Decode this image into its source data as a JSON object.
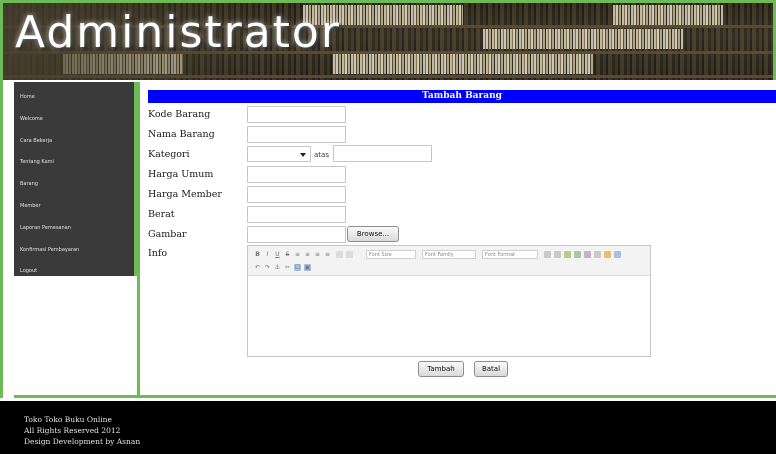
{
  "header": {
    "title": "Administrator"
  },
  "sidebar": {
    "items": [
      {
        "label": "Home"
      },
      {
        "label": "Welcome"
      },
      {
        "label": "Cara Bekerja"
      },
      {
        "label": "Tentang Kami"
      },
      {
        "label": "Barang"
      },
      {
        "label": "Member"
      },
      {
        "label": "Laporan Pemesanan"
      },
      {
        "label": "Konfirmasi Pembayaran"
      },
      {
        "label": "Logout"
      }
    ]
  },
  "form": {
    "title": "Tambah Barang",
    "kode_label": "Kode Barang",
    "kode_value": "",
    "nama_label": "Nama Barang",
    "nama_value": "",
    "kategori_label": "Kategori",
    "kategori_selected": "",
    "atas_label": "atas",
    "atas_value": "",
    "harga_umum_label": "Harga Umum",
    "harga_umum_value": "",
    "harga_member_label": "Harga Member",
    "harga_member_value": "",
    "berat_label": "Berat",
    "berat_value": "",
    "gambar_label": "Gambar",
    "browse_label": "Browse...",
    "info_label": "Info",
    "submit_label": "Tambah",
    "cancel_label": "Batal"
  },
  "editor": {
    "font_size_label": "Font Size",
    "font_family_label": "Font Family",
    "font_format_label": "Font Format",
    "toolbar_row1": [
      "B",
      "I",
      "U",
      "S",
      "≡",
      "≡",
      "≡",
      "≡"
    ],
    "toolbar_row2": [
      "↶",
      "↷",
      "⚓",
      "✂",
      "☐",
      "▣"
    ]
  },
  "footer": {
    "line1": "Toko Toko Buku Online",
    "line2": "All Rights Reserved 2012",
    "line3": "Design Development by Asnan"
  },
  "colors": {
    "frame_green": "#6dbb55",
    "title_bar_blue": "#0000ff",
    "sidebar_bg": "#3a3a3a",
    "footer_bg": "#000000"
  }
}
